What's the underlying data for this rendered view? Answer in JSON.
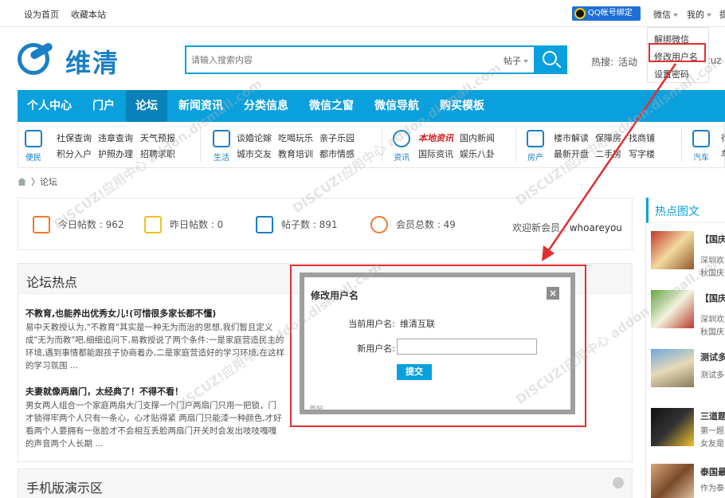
{
  "topbar": {
    "set_home": "设为首页",
    "bookmark": "收藏本站",
    "qq_bind": "QQ帐号绑定",
    "wechat": "微信",
    "mine": "我的",
    "cut": "提"
  },
  "dropdown": {
    "items": [
      "解绑微信",
      "修改用户名",
      "设置密码"
    ]
  },
  "logo": {
    "text": "维清"
  },
  "search": {
    "placeholder": "请输入搜索内容",
    "type": "帖子",
    "hot_label": "热搜:",
    "hot_keywords": [
      "活动"
    ],
    "hot_cut": "cuz"
  },
  "nav": {
    "items": [
      "个人中心",
      "门户",
      "论坛",
      "新闻资讯",
      "分类信息",
      "微信之窗",
      "微信导航",
      "购买模板"
    ],
    "active": "论坛"
  },
  "categories": [
    {
      "label": "便民",
      "icon": "umbrella-icon",
      "links": [
        [
          "社保查询",
          "违章查询",
          "天气预报"
        ],
        [
          "积分入户",
          "护照办理",
          "招聘求职"
        ]
      ]
    },
    {
      "label": "生活",
      "icon": "cup-icon",
      "links": [
        [
          "谈婚论嫁",
          "吃喝玩乐",
          "亲子乐园"
        ],
        [
          "城市交友",
          "教育培训",
          "都市情感"
        ]
      ]
    },
    {
      "label": "资讯",
      "icon": "globe-icon",
      "highlight": "本地资讯",
      "links": [
        [
          "本地资讯",
          "国内新闻"
        ],
        [
          "国际资讯",
          "娱乐八卦"
        ]
      ]
    },
    {
      "label": "房产",
      "icon": "house-icon",
      "links": [
        [
          "楼市解读",
          "保障房",
          "找商铺"
        ],
        [
          "最新开盘",
          "二手房",
          "写字楼"
        ]
      ]
    },
    {
      "label": "汽车",
      "icon": "car-icon",
      "links": [
        [
          "行"
        ],
        [
          "车"
        ]
      ]
    }
  ],
  "breadcrumb": {
    "current": "论坛"
  },
  "stats": {
    "today": "今日帖数 : 962",
    "yesterday": "昨日帖数 : 0",
    "posts": "帖子数 : 891",
    "members": "会员总数 : 49",
    "welcome_prefix": "欢迎新会员 : ",
    "new_member": "whoareyou"
  },
  "hot_section": {
    "title": "论坛热点",
    "posts": [
      {
        "title": "不教育,也能养出优秀女儿!(可惜很多家长都不懂)",
        "body": [
          "易中天教授认为,\"不教育\"其实是一种无为而治的思想,我们暂且定义",
          "成\"无为而教\"吧,细细追问下,易教授说了两个条件:一是家庭营造民主的",
          "环境,遇到事情都能跟孩子协商着办,二是家庭营造好的学习环境,在这样",
          "的学习氛围 ..."
        ]
      },
      {
        "title": "夫妻就像两扇门，太经典了！不得不看！",
        "body": [
          "男女两人组合一个家庭两扇大门支撑一个门户两扇门只用一把锁，门",
          "才锁得牢两个人只有一条心，心才贴得紧 两扇门只能漆一种颜色,才好",
          "看两个人要拥有一张脸才不会相互丢脸两扇门开关时会发出吱吱嘎嘎",
          "的声音两个人长期 ..."
        ]
      }
    ]
  },
  "mobile_section": {
    "title": "手机版演示区"
  },
  "sidebar": {
    "title": "热点图文",
    "items": [
      {
        "title": "【国庆",
        "desc": [
          "深圳欢",
          "秋国庆"
        ]
      },
      {
        "title": "【国庆",
        "desc": [
          "深圳欢",
          "秋国庆"
        ]
      },
      {
        "title": "测试多",
        "desc": [
          "测试多"
        ]
      },
      {
        "title": "三道题",
        "desc": [
          "第一题",
          "女友是"
        ]
      },
      {
        "title": "泰国最",
        "desc": [
          "作为泰"
        ]
      }
    ]
  },
  "modal": {
    "title": "修改用户名",
    "current_label": "当前用户名:",
    "current_value": "维清互联",
    "new_label": "新用户名:",
    "new_value": "",
    "submit": "提交",
    "fragment": "首帖"
  },
  "watermark": "DISCUZ!应用中心 addon.dismall.com",
  "colors": {
    "accent": "#0aa0dd",
    "nav_active": "#0882b8",
    "highlight_red": "#e03030",
    "logo_blue": "#1a7fc4"
  }
}
